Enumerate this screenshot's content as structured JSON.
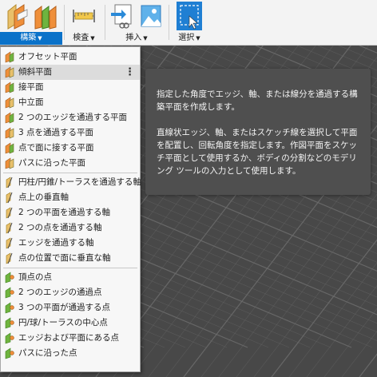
{
  "toolbar": {
    "groups": [
      {
        "label": "構築",
        "icons": [
          "offset-plane-icon",
          "midplane-icon"
        ]
      },
      {
        "label": "検査",
        "icons": [
          "measure-icon"
        ]
      },
      {
        "label": "挿入",
        "icons": [
          "insert-derive-icon",
          "insert-canvas-icon"
        ]
      },
      {
        "label": "選択",
        "icons": [
          "window-select-icon"
        ]
      }
    ],
    "accent_color": "#0a72c9"
  },
  "menu": {
    "items": [
      {
        "label": "オフセット平面",
        "icon": "offset-plane-icon"
      },
      {
        "label": "傾斜平面",
        "icon": "plane-at-angle-icon"
      },
      {
        "label": "接平面",
        "icon": "tangent-plane-icon"
      },
      {
        "label": "中立面",
        "icon": "midplane-icon"
      },
      {
        "label": "2 つのエッジを通過する平面",
        "icon": "plane-through-two-edges-icon"
      },
      {
        "label": "3 点を通過する平面",
        "icon": "plane-through-three-points-icon"
      },
      {
        "label": "点で面に接する平面",
        "icon": "plane-tangent-at-point-icon"
      },
      {
        "label": "パスに沿った平面",
        "icon": "plane-along-path-icon"
      },
      {
        "label": "円柱/円錐/トーラスを通過する軸",
        "icon": "axis-through-cylinder-icon"
      },
      {
        "label": "点上の垂直軸",
        "icon": "axis-perpendicular-at-point-icon"
      },
      {
        "label": "2 つの平面を通過する軸",
        "icon": "axis-through-two-planes-icon"
      },
      {
        "label": "2 つの点を通過する軸",
        "icon": "axis-through-two-points-icon"
      },
      {
        "label": "エッジを通過する軸",
        "icon": "axis-through-edge-icon"
      },
      {
        "label": "点の位置で面に垂直な軸",
        "icon": "axis-perpendicular-to-face-icon"
      },
      {
        "label": "頂点の点",
        "icon": "point-at-vertex-icon"
      },
      {
        "label": "2 つのエッジの通過点",
        "icon": "point-through-two-edges-icon"
      },
      {
        "label": "3 つの平面が通過する点",
        "icon": "point-through-three-planes-icon"
      },
      {
        "label": "円/球/トーラスの中心点",
        "icon": "point-at-center-icon"
      },
      {
        "label": "エッジおよび平面にある点",
        "icon": "point-at-edge-and-plane-icon"
      },
      {
        "label": "パスに沿った点",
        "icon": "point-along-path-icon"
      }
    ],
    "highlighted_index": 1,
    "more_icon": "more-options-icon"
  },
  "tooltip": {
    "description": "指定した角度でエッジ、軸、または線分を通過する構築平面を作成します。",
    "detail": "直線状エッジ、軸、またはスケッチ線を選択して平面を配置し、回転角度を指定します。作図平面をスケッチ平面として使用するか、ボディの分割などのモデリング ツールの入力として使用します。"
  }
}
